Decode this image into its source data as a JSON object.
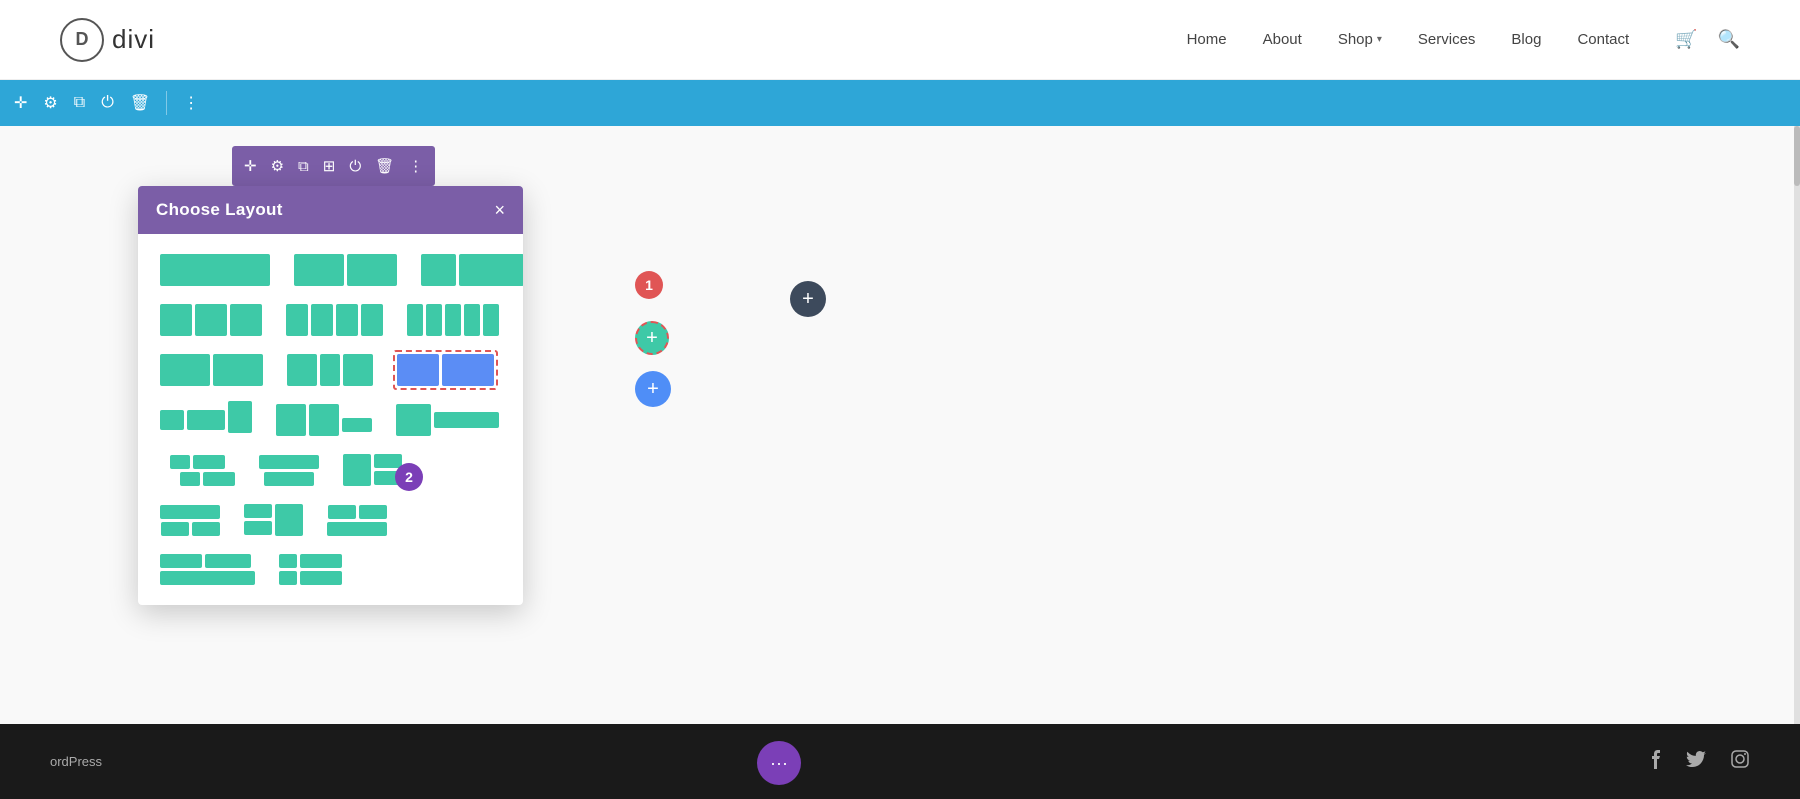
{
  "logo": {
    "letter": "D",
    "name": "divi"
  },
  "nav": {
    "items": [
      {
        "label": "Home",
        "has_chevron": false
      },
      {
        "label": "About",
        "has_chevron": false
      },
      {
        "label": "Shop",
        "has_chevron": true
      },
      {
        "label": "Services",
        "has_chevron": true
      },
      {
        "label": "Blog",
        "has_chevron": false
      },
      {
        "label": "Contact",
        "has_chevron": false
      }
    ]
  },
  "toolbar": {
    "icons": [
      "plus",
      "gear",
      "copy",
      "power",
      "trash",
      "dots"
    ]
  },
  "row_toolbar": {
    "icons": [
      "move",
      "gear",
      "copy",
      "columns",
      "power",
      "trash",
      "dots"
    ]
  },
  "modal": {
    "title": "Choose Layout",
    "close_label": "×"
  },
  "footer": {
    "text": "ordPress",
    "social_icons": [
      "facebook",
      "twitter",
      "instagram"
    ]
  },
  "badges": [
    {
      "id": "badge-1",
      "label": "1"
    },
    {
      "id": "badge-2",
      "label": "2"
    }
  ],
  "bottom_btn_dots": "···"
}
